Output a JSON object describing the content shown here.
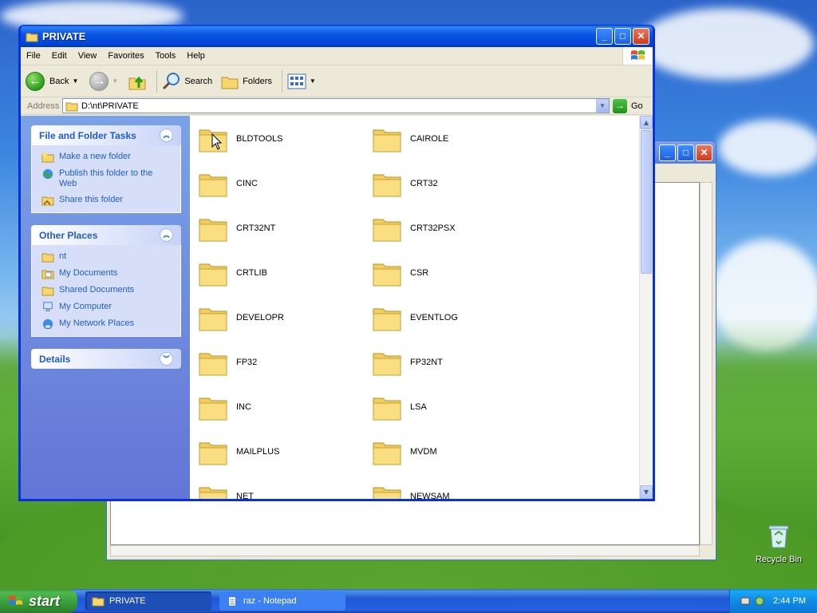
{
  "explorer": {
    "title": "PRIVATE",
    "menu": [
      "File",
      "Edit",
      "View",
      "Favorites",
      "Tools",
      "Help"
    ],
    "toolbar": {
      "back": "Back",
      "search": "Search",
      "folders": "Folders"
    },
    "address": {
      "label": "Address",
      "path": "D:\\nt\\PRIVATE",
      "go": "Go"
    },
    "tasks": {
      "file_folder": {
        "title": "File and Folder Tasks",
        "links": [
          "Make a new folder",
          "Publish this folder to the Web",
          "Share this folder"
        ]
      },
      "other_places": {
        "title": "Other Places",
        "links": [
          "nt",
          "My Documents",
          "Shared Documents",
          "My Computer",
          "My Network Places"
        ]
      },
      "details": {
        "title": "Details"
      }
    },
    "folders": [
      "BLDTOOLS",
      "CAIROLE",
      "CINC",
      "CRT32",
      "CRT32NT",
      "CRT32PSX",
      "CRTLIB",
      "CSR",
      "DEVELOPR",
      "EVENTLOG",
      "FP32",
      "FP32NT",
      "INC",
      "LSA",
      "MAILPLUS",
      "MVDM",
      "NET",
      "NEWSAM"
    ]
  },
  "desktop": {
    "recycle_bin": "Recycle Bin"
  },
  "taskbar": {
    "start": "start",
    "tasks": [
      "PRIVATE",
      "raz - Notepad"
    ],
    "clock": "2:44 PM"
  }
}
